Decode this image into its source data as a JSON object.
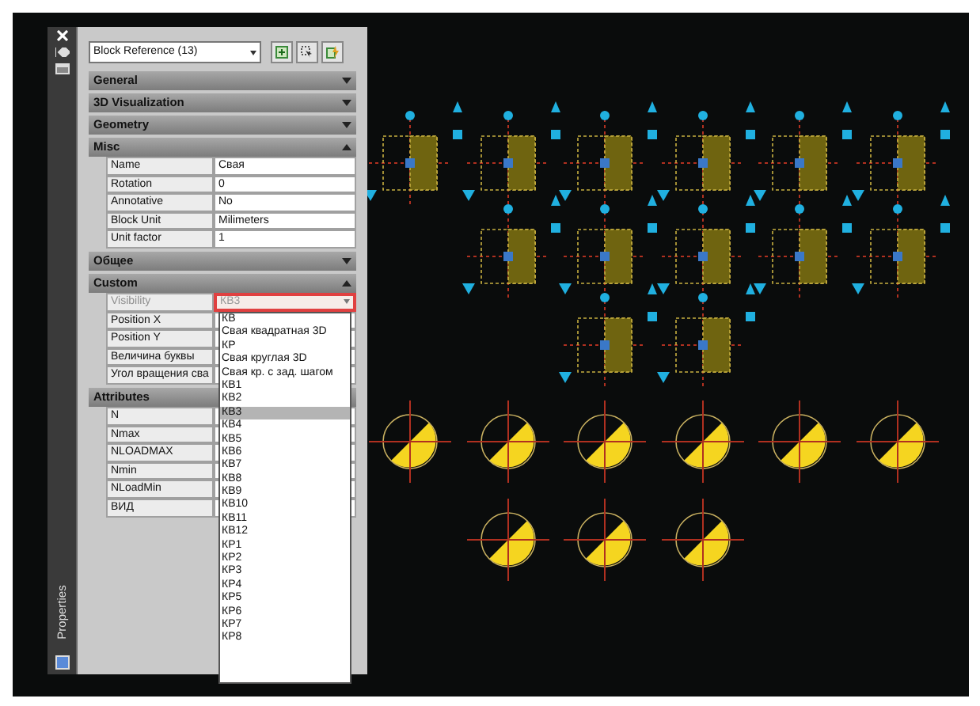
{
  "palette": {
    "title": "Properties"
  },
  "object_selector": {
    "value": "Block Reference (13)"
  },
  "sections": [
    {
      "title": "General",
      "expanded": false
    },
    {
      "title": "3D Visualization",
      "expanded": false
    },
    {
      "title": "Geometry",
      "expanded": false
    },
    {
      "title": "Misc",
      "expanded": true,
      "rows": [
        {
          "name": "Name",
          "value": "Свая",
          "kind": "text"
        },
        {
          "name": "Rotation",
          "value": "0",
          "kind": "text"
        },
        {
          "name": "Annotative",
          "value": "No",
          "kind": "text"
        },
        {
          "name": "Block Unit",
          "value": "Milimeters",
          "kind": "text"
        },
        {
          "name": "Unit factor",
          "value": "1",
          "kind": "text"
        }
      ]
    },
    {
      "title": "Общее",
      "expanded": false
    },
    {
      "title": "Custom",
      "expanded": true,
      "rows": [
        {
          "name": "Visibility",
          "value": "КВ3",
          "kind": "dropdown"
        },
        {
          "name": "Position X",
          "kind": "text"
        },
        {
          "name": "Position Y",
          "kind": "text"
        },
        {
          "name": "Величина буквы",
          "kind": "text"
        },
        {
          "name": "Угол вращения сва",
          "kind": "text"
        }
      ]
    },
    {
      "title": "Attributes",
      "expanded": true,
      "rows": [
        {
          "name": "N",
          "kind": "text"
        },
        {
          "name": "Nmax",
          "kind": "text"
        },
        {
          "name": "NLOADMAX",
          "kind": "text"
        },
        {
          "name": "Nmin",
          "kind": "text"
        },
        {
          "name": "NLoadMin",
          "kind": "text"
        },
        {
          "name": "ВИД",
          "kind": "text"
        }
      ]
    }
  ],
  "dropdown_list": {
    "options": [
      {
        "label": "КВ",
        "selected": false
      },
      {
        "label": "Свая квадратная 3D",
        "selected": false
      },
      {
        "label": "КР",
        "selected": false
      },
      {
        "label": "Свая круглая 3D",
        "selected": false
      },
      {
        "label": "Свая кр. с зад. шагом",
        "selected": false
      },
      {
        "label": "КВ1",
        "selected": false
      },
      {
        "label": "КВ2",
        "selected": false
      },
      {
        "label": "КВ3",
        "selected": true
      },
      {
        "label": "КВ4",
        "selected": false
      },
      {
        "label": "КВ5",
        "selected": false
      },
      {
        "label": "КВ6",
        "selected": false
      },
      {
        "label": "КВ7",
        "selected": false
      },
      {
        "label": "КВ8",
        "selected": false
      },
      {
        "label": "КВ9",
        "selected": false
      },
      {
        "label": "КВ10",
        "selected": false
      },
      {
        "label": "КВ11",
        "selected": false
      },
      {
        "label": "КВ12",
        "selected": false
      },
      {
        "label": "КР1",
        "selected": false
      },
      {
        "label": "КР2",
        "selected": false
      },
      {
        "label": "КР3",
        "selected": false
      },
      {
        "label": "КР4",
        "selected": false
      },
      {
        "label": "КР5",
        "selected": false
      },
      {
        "label": "КР6",
        "selected": false
      },
      {
        "label": "КР7",
        "selected": false
      },
      {
        "label": "КР8",
        "selected": false
      }
    ]
  }
}
